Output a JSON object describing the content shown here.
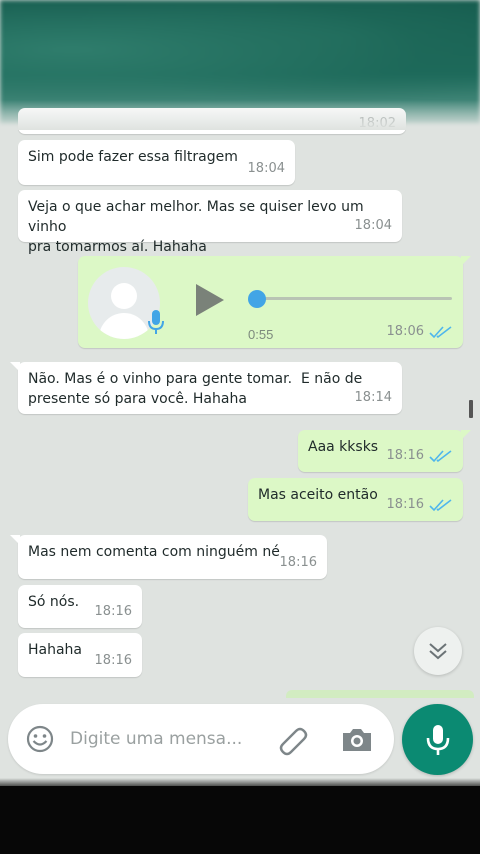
{
  "messages": [
    {
      "type": "in",
      "text": "Sim pode fazer essa filtragem",
      "time": "18:04"
    },
    {
      "type": "in",
      "text": "Veja o que achar melhor. Mas se quiser levo um vinho\npra tomarmos aí. Hahaha",
      "time": "18:04"
    },
    {
      "type": "audio",
      "duration": "0:55",
      "time": "18:06",
      "status": "read",
      "progress": 0.0
    },
    {
      "type": "in",
      "text": "Não. Mas é o vinho para gente tomar.  E não de\npresente só para você. Hahaha",
      "time": "18:14"
    },
    {
      "type": "out",
      "text": "Aaa kksks",
      "time": "18:16",
      "status": "read"
    },
    {
      "type": "out",
      "text": "Mas aceito então",
      "time": "18:16",
      "status": "read"
    },
    {
      "type": "in",
      "text": "Mas nem comenta com ninguém né",
      "time": "18:16"
    },
    {
      "type": "in",
      "text": "Só nós.",
      "time": "18:16"
    },
    {
      "type": "in",
      "text": "Hahaha",
      "time": "18:16"
    }
  ],
  "partial_top_message_time": "18:02",
  "composer": {
    "placeholder": "Digite uma mensa...",
    "icons": [
      "emoji-icon",
      "paperclip-icon",
      "camera-icon",
      "microphone-icon"
    ]
  },
  "colors": {
    "incoming_bubble": "#ffffff",
    "outgoing_bubble": "#dcf8c6",
    "read_ticks": "#4fb6ec",
    "accent": "#0b8a72",
    "chat_background": "#dfe3e0"
  }
}
